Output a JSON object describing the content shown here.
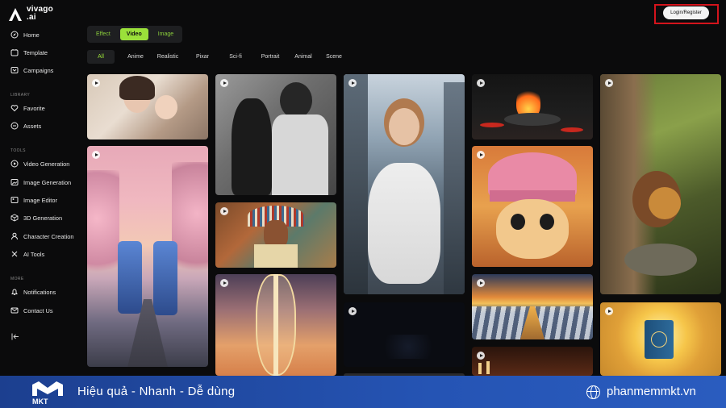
{
  "brand": {
    "line1": "vivago",
    "line2": ".ai"
  },
  "nav": {
    "main": [
      {
        "label": "Home",
        "icon": "compass-icon"
      },
      {
        "label": "Template",
        "icon": "template-icon"
      },
      {
        "label": "Campaigns",
        "icon": "campaign-icon"
      }
    ],
    "library_title": "LIBRARY",
    "library": [
      {
        "label": "Favorite",
        "icon": "heart-icon"
      },
      {
        "label": "Assets",
        "icon": "assets-icon"
      }
    ],
    "tools_title": "TOOLS",
    "tools": [
      {
        "label": "Video Generation",
        "icon": "video-icon"
      },
      {
        "label": "Image Generation",
        "icon": "image-icon"
      },
      {
        "label": "Image Editor",
        "icon": "editor-icon"
      },
      {
        "label": "3D Generation",
        "icon": "cube-icon"
      },
      {
        "label": "Character Creation",
        "icon": "person-icon"
      },
      {
        "label": "AI Tools",
        "icon": "tools-icon"
      }
    ],
    "more_title": "MORE",
    "more": [
      {
        "label": "Notifications",
        "icon": "bell-icon"
      },
      {
        "label": "Contact Us",
        "icon": "mail-icon"
      }
    ]
  },
  "header": {
    "login_label": "Login/Register"
  },
  "type_tabs": [
    "Effect",
    "Video",
    "Image"
  ],
  "active_type": "Video",
  "filters": [
    "All",
    "Anime",
    "Realistic",
    "Pixar",
    "Sci-fi",
    "Portrait",
    "Animal",
    "Scene"
  ],
  "active_filter": "All",
  "banner": {
    "logo_text": "MKT",
    "slogan": "Hiệu quả - Nhanh - Dễ dùng",
    "website": "phanmemmkt.vn"
  }
}
